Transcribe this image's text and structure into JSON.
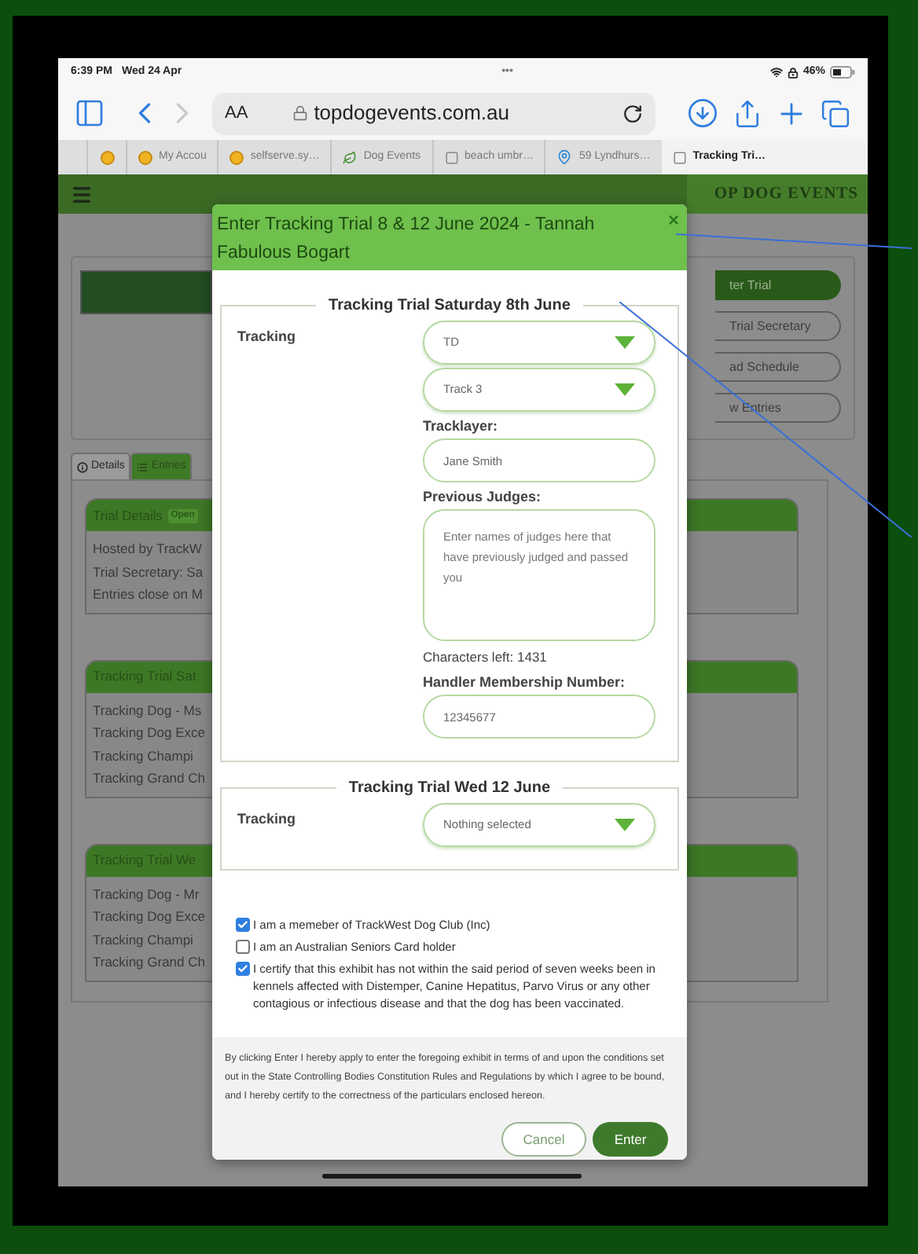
{
  "status_bar": {
    "time": "6:39 PM",
    "date": "Wed 24 Apr",
    "dots": "•••",
    "battery": "46%"
  },
  "browser": {
    "text_size_button": "AA",
    "url": "topdogevents.com.au",
    "tabs": [
      {
        "kind": "coin",
        "selected": false
      },
      {
        "kind": "coin",
        "label": "My Accou",
        "selected": false
      },
      {
        "kind": "coin",
        "label": "selfserve.sy…",
        "selected": false
      },
      {
        "kind": "leaf",
        "label": "Dog Events",
        "selected": false
      },
      {
        "kind": "page",
        "label": "beach umbr…",
        "selected": false
      },
      {
        "kind": "pin",
        "label": "59 Lyndhurs…",
        "selected": false
      },
      {
        "kind": "page",
        "label": "Tracking Tri…",
        "selected": true
      }
    ]
  },
  "page": {
    "header": {
      "brand": "OP DOG EVENTS"
    },
    "side_buttons": [
      {
        "label": "ter Trial",
        "kind": "primary"
      },
      {
        "label": "Trial Secretary",
        "kind": "outline"
      },
      {
        "label": "ad Schedule",
        "kind": "outline"
      },
      {
        "label": "w Entries",
        "kind": "outline"
      }
    ],
    "tabs": [
      {
        "label": "Details",
        "selected": true
      },
      {
        "label": "Entries",
        "selected": false
      }
    ],
    "cards": [
      {
        "title": "Trial Details",
        "badge": "Open",
        "lines": [
          "Hosted by TrackW",
          "Trial Secretary: Sa",
          "Entries close on M"
        ]
      },
      {
        "title": "Tracking Trial Sat",
        "lines": [
          "Tracking Dog - Ms",
          "Tracking Dog Exce",
          "Tracking Champi",
          "Tracking Grand Ch"
        ]
      },
      {
        "title": "Tracking Trial We",
        "lines": [
          "Tracking Dog - Mr",
          "Tracking Dog Exce",
          "Tracking Champi",
          "Tracking Grand Ch"
        ]
      }
    ]
  },
  "modal": {
    "title": "Enter Tracking Trial 8 & 12 June 2024 - Tannah Fabulous Bogart",
    "close": "×",
    "sections": [
      {
        "legend": "Tracking Trial Saturday 8th June",
        "label": "Tracking",
        "fields": [
          {
            "kind": "select",
            "value": "TD"
          },
          {
            "kind": "select",
            "value": "Track 3"
          },
          {
            "kind": "input",
            "label": "Tracklayer:",
            "value": "Jane Smith"
          },
          {
            "kind": "textarea",
            "label": "Previous Judges:",
            "placeholder": "Enter names of judges here that have previously judged and passed you",
            "note": "Characters left: 1431"
          },
          {
            "kind": "input",
            "label": "Handler Membership Number:",
            "value": "12345677"
          }
        ]
      },
      {
        "legend": "Tracking Trial Wed 12 June",
        "label": "Tracking",
        "fields": [
          {
            "kind": "select",
            "value": "Nothing selected"
          }
        ]
      }
    ],
    "checkboxes": [
      {
        "label": "I am a memeber of TrackWest Dog Club (Inc)",
        "checked": true
      },
      {
        "label": "I am an Australian Seniors Card holder",
        "checked": false
      },
      {
        "label": "I certify that this exhibit has not within the said period of seven weeks been in kennels affected with Distemper, Canine Hepatitus, Parvo Virus or any other contagious or infectious disease and that the dog has been vaccinated.",
        "checked": true
      }
    ],
    "disclaimer": "By clicking Enter I hereby apply to enter the foregoing exhibit in terms of and upon the conditions set out in the State Controlling Bodies Constitution Rules and Regulations by which I agree to be bound, and I hereby certify to the correctness of the particulars enclosed hereon.",
    "buttons": [
      {
        "label": "Cancel",
        "kind": "secondary"
      },
      {
        "label": "Enter",
        "kind": "primary"
      }
    ]
  }
}
